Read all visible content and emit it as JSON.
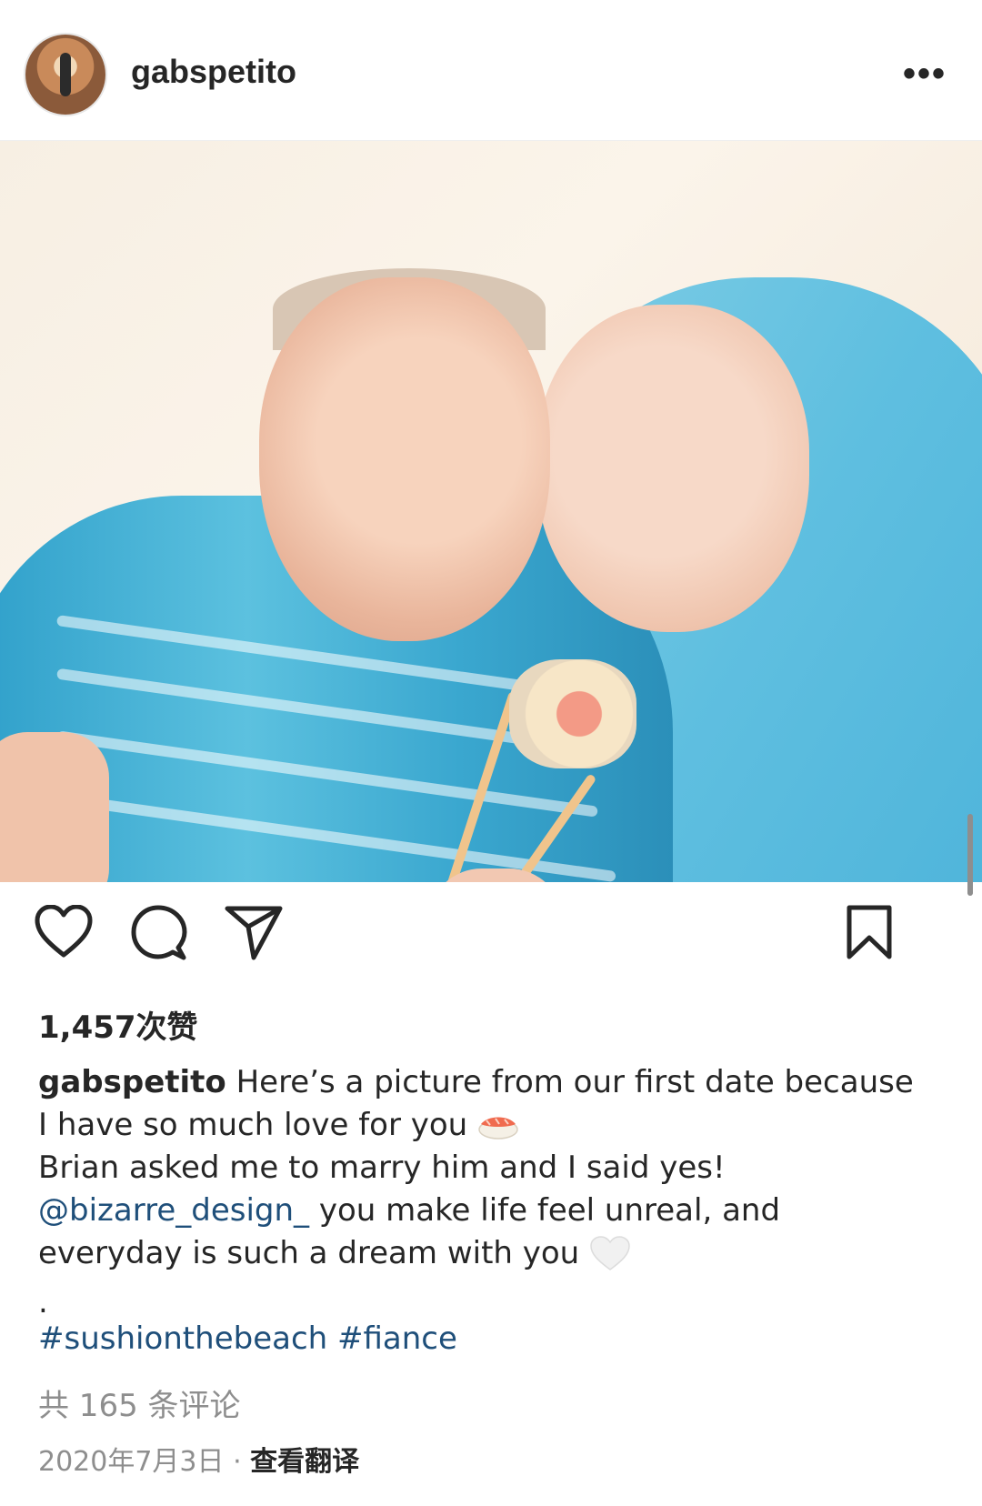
{
  "header": {
    "username": "gabspetito",
    "more_icon": "more-horizontal-icon"
  },
  "post": {
    "photo_description_icon": "post-photo"
  },
  "actions": {
    "like_icon": "heart-icon",
    "comment_icon": "comment-icon",
    "share_icon": "send-icon",
    "save_icon": "bookmark-icon"
  },
  "likes": {
    "label": "1,457次赞"
  },
  "caption": {
    "username": "gabspetito",
    "line1": " Here’s a picture from our first date because",
    "line2": "I have so much love for you ",
    "line3": "Brian asked me to marry him and I said yes!",
    "mention": "@bizarre_design_",
    "line4_rest": " you make life feel unreal, and",
    "line5": "everyday is such a dream with you ",
    "dot": ".",
    "hashtag1": "#sushionthebeach",
    "hashtag2": "#fiance"
  },
  "comments": {
    "label": "共 165 条评论"
  },
  "meta": {
    "date": "2020年7月3日",
    "separator": " · ",
    "translate_label": "查看翻译"
  },
  "colors": {
    "link": "#1f4f7a",
    "muted": "#8e8e8e",
    "text": "#262626"
  }
}
